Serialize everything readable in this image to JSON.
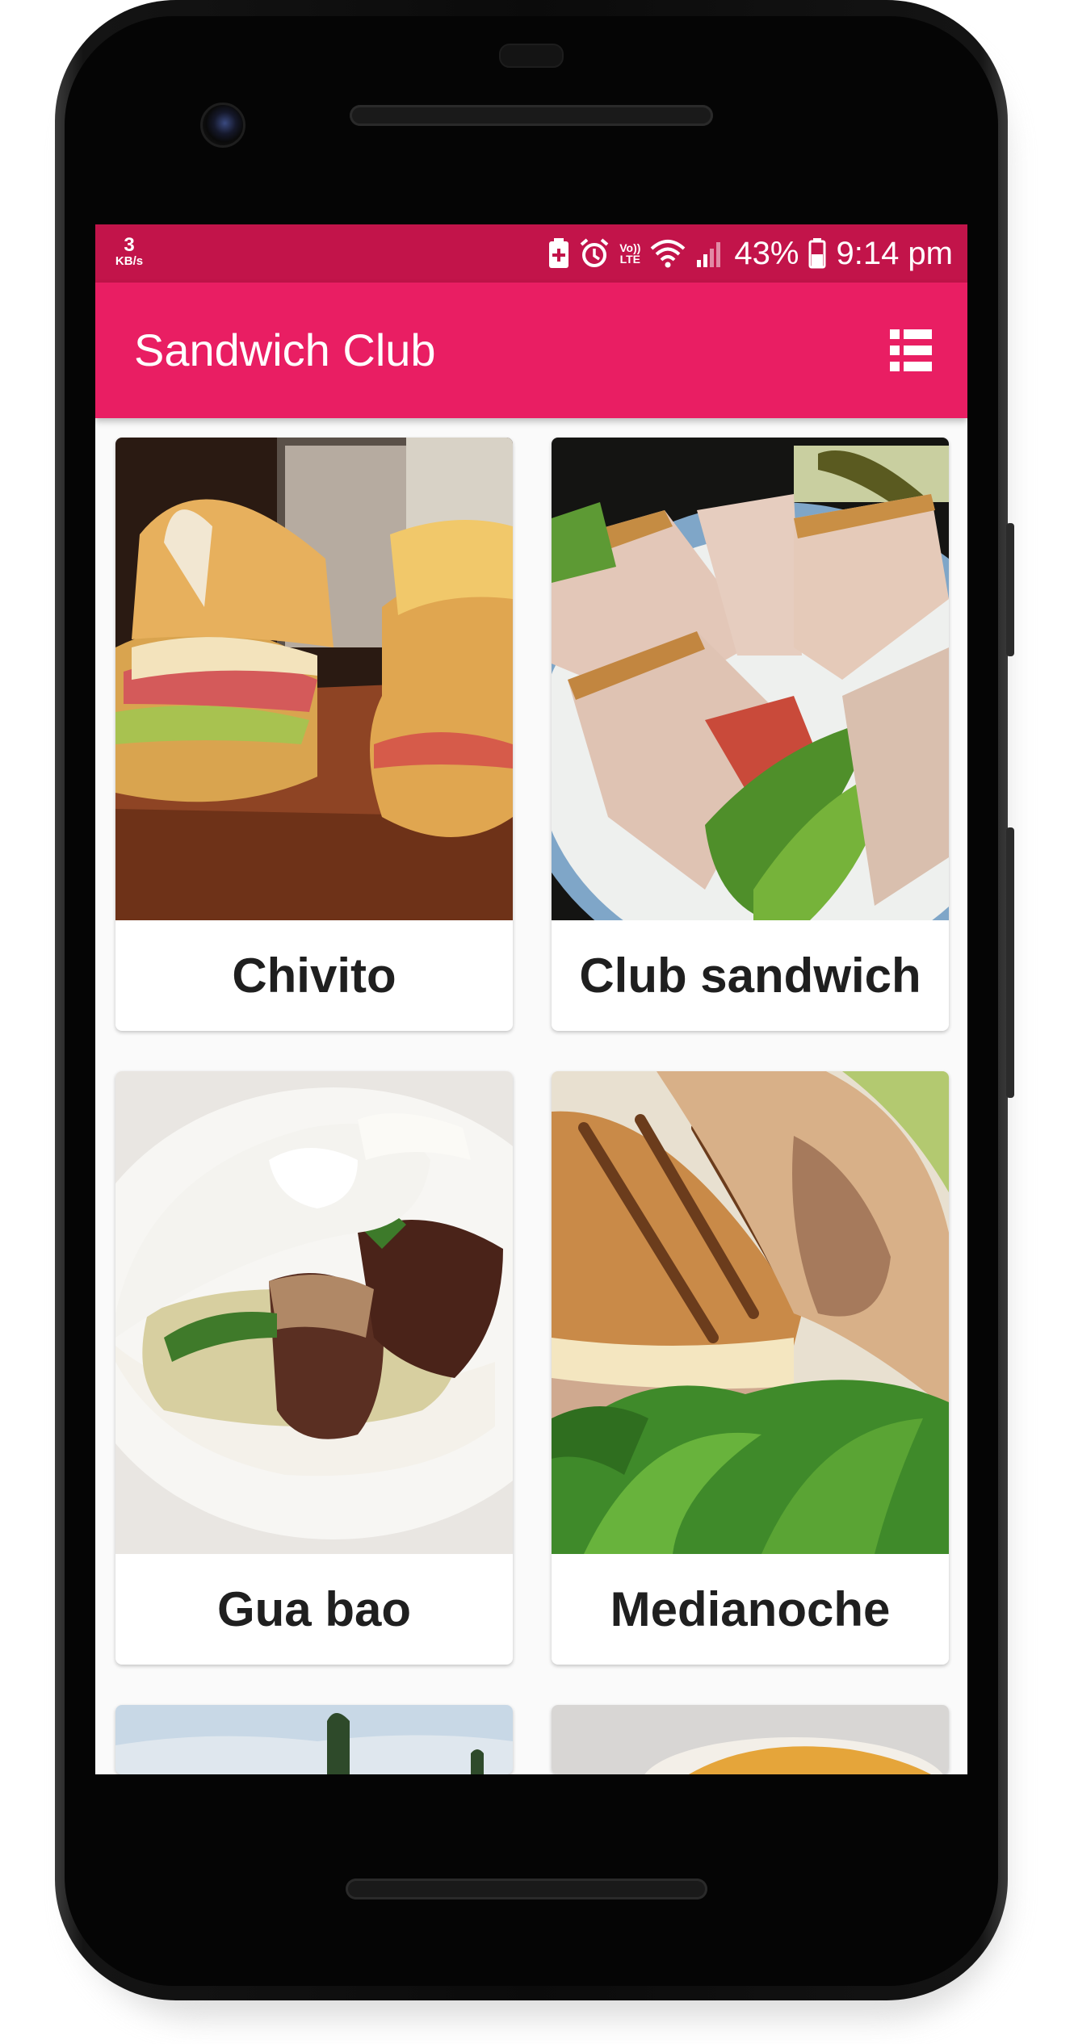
{
  "status_bar": {
    "net_speed_value": "3",
    "net_speed_unit": "KB/s",
    "volte_line1": "Vo))",
    "volte_line2": "LTE",
    "battery_percent": "43%",
    "time": "9:14 pm"
  },
  "app_bar": {
    "title": "Sandwich Club",
    "action_icon": "view-list-icon"
  },
  "sandwiches": [
    {
      "name": "Chivito"
    },
    {
      "name": "Club sandwich"
    },
    {
      "name": "Gua bao"
    },
    {
      "name": "Medianoche"
    }
  ],
  "colors": {
    "status_bar": "#c2144a",
    "app_bar": "#e91e63",
    "background": "#fafafa",
    "card_text": "#1f1f1f"
  }
}
